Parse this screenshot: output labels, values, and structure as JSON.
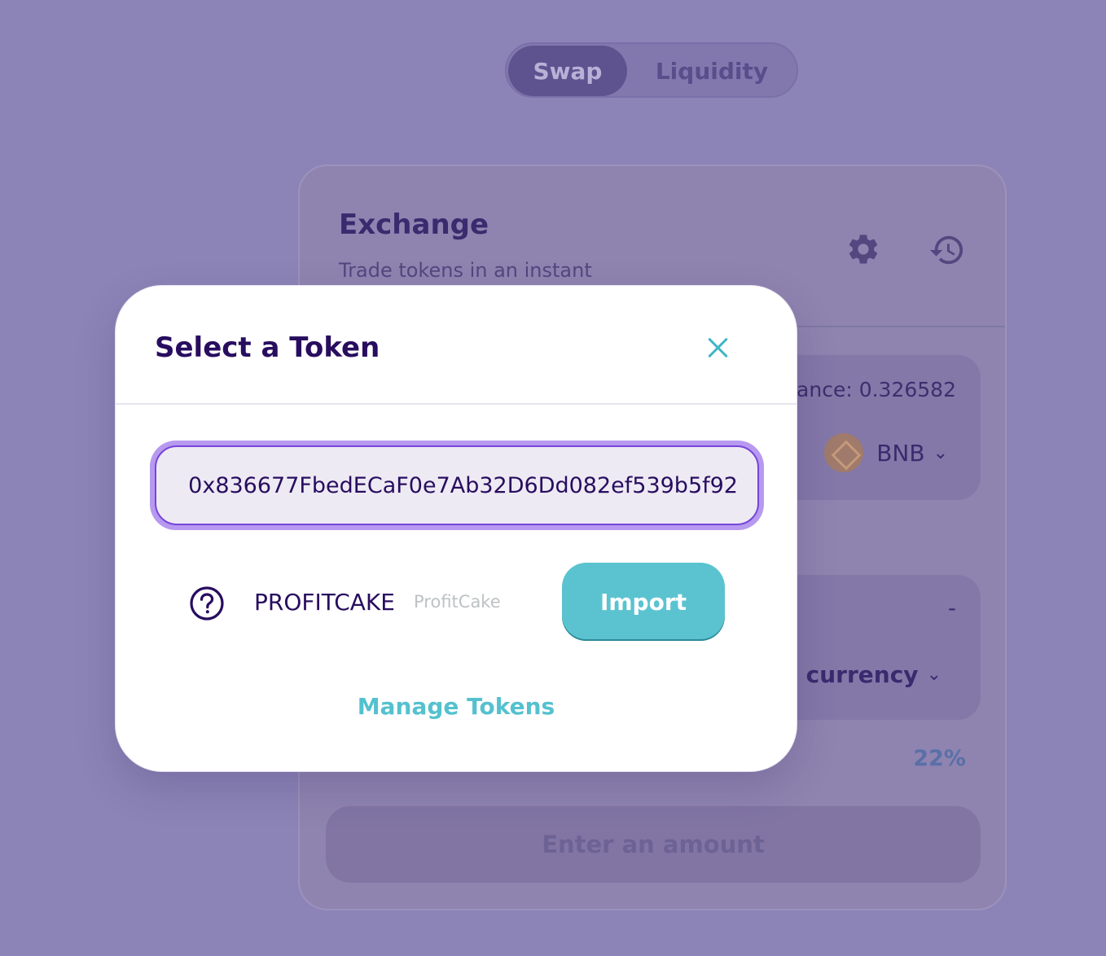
{
  "nav": {
    "swap": "Swap",
    "liquidity": "Liquidity"
  },
  "card": {
    "title": "Exchange",
    "subtitle": "Trade tokens in an instant",
    "icons": {
      "settings": "gear-icon",
      "history": "history-icon"
    },
    "from": {
      "balance": "lance: 0.326582",
      "token": "BNB"
    },
    "to": {
      "balance": "-",
      "token": "currency"
    },
    "slippage": "22%",
    "action": "Enter an amount"
  },
  "modal": {
    "title": "Select a Token",
    "search_value": "0x836677FbedECaF0e7Ab32D6Dd082ef539b5f92",
    "result": {
      "symbol": "PROFITCAKE",
      "name": "ProfitCake",
      "import_label": "Import"
    },
    "manage_label": "Manage Tokens"
  },
  "colors": {
    "overlay": "#8c84b6",
    "primary": "#280d5f",
    "accent_teal": "#5bc3d0",
    "focus_purple": "#7645d9"
  }
}
